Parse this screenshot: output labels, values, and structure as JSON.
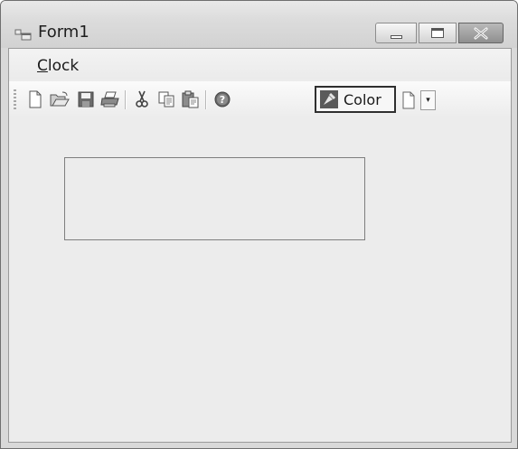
{
  "window": {
    "title": "Form1",
    "icon": "form-icon"
  },
  "caption_buttons": [
    "minimize-icon",
    "maximize-icon",
    "close-icon"
  ],
  "menu": {
    "items": [
      {
        "label_mnemonic": "C",
        "label_rest": "lock"
      }
    ]
  },
  "toolbar": {
    "buttons": [
      "new-icon",
      "open-icon",
      "save-icon",
      "print-icon",
      "cut-icon",
      "copy-icon",
      "paste-icon",
      "help-icon"
    ],
    "color_button": {
      "label": "Color",
      "icon": "color-picker-icon"
    },
    "split_button": {
      "icon": "new-icon",
      "arrow": "▾"
    }
  },
  "panel": {
    "content": ""
  }
}
